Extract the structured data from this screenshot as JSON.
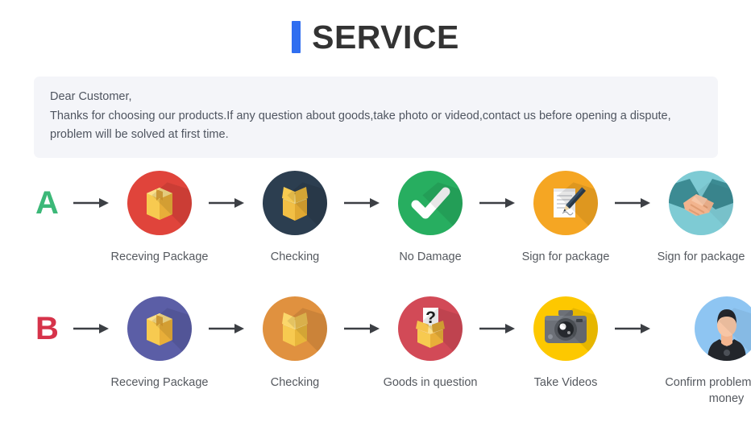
{
  "header": {
    "title": "SERVICE",
    "accent_color": "#2f6ef0"
  },
  "notice": {
    "lines": [
      "Dear Customer,",
      "Thanks for choosing our products.If any question about goods,take photo or videod,contact us before opening a dispute,",
      "problem will be solved at first time."
    ],
    "background_color": "#f4f5f9",
    "text_color": "#4f5560"
  },
  "rows": [
    {
      "letter": "A",
      "letter_color": "#3cb878",
      "steps": [
        {
          "label": "Receving Package",
          "icon": "closed-box-icon",
          "circle_color": "#e0443b"
        },
        {
          "label": "Checking",
          "icon": "open-box-icon",
          "circle_color": "#2c3e50"
        },
        {
          "label": "No Damage",
          "icon": "check-mark-icon",
          "circle_color": "#27ae60"
        },
        {
          "label": "Sign for package",
          "icon": "document-pen-icon",
          "circle_color": "#f5a623"
        },
        {
          "label": "Sign for package",
          "icon": "handshake-icon",
          "circle_color": "#7ecbd4"
        }
      ]
    },
    {
      "letter": "B",
      "letter_color": "#d6334a",
      "steps": [
        {
          "label": "Receving Package",
          "icon": "closed-box-icon",
          "circle_color": "#5b5ea6"
        },
        {
          "label": "Checking",
          "icon": "open-box-icon",
          "circle_color": "#e0913f"
        },
        {
          "label": "Goods in question",
          "icon": "question-box-icon",
          "circle_color": "#d24a57"
        },
        {
          "label": "Take Videos",
          "icon": "camera-icon",
          "circle_color": "#fdc800"
        },
        {
          "label": "Confirm  problem,refund money",
          "icon": "person-avatar-icon",
          "circle_color": "#8ec5f2"
        }
      ]
    }
  ],
  "arrow": {
    "color": "#3c3f44",
    "glyph": "right-arrow"
  }
}
